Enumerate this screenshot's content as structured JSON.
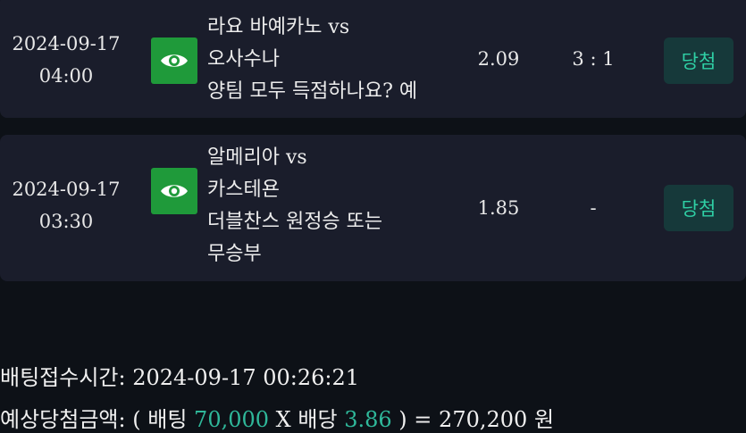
{
  "bets": [
    {
      "date": "2024-09-17",
      "time": "04:00",
      "match_lines": [
        "라요 바예카노 vs",
        "오사수나",
        "양팀 모두 득점하나요? 예"
      ],
      "odds": "2.09",
      "score": "3 : 1",
      "result": "당첨"
    },
    {
      "date": "2024-09-17",
      "time": "03:30",
      "match_lines": [
        "알메리아 vs",
        "카스테욘",
        "더블찬스 원정승 또는",
        "무승부"
      ],
      "odds": "1.85",
      "score": "-",
      "result": "당첨"
    }
  ],
  "summary": {
    "bet_time_label": "배팅접수시간:",
    "bet_time_value": "2024-09-17 00:26:21",
    "expected_label": "예상당첨금액:",
    "open_paren": "(",
    "stake_label": "배팅",
    "stake_value": "70,000",
    "times": "X",
    "odds_label": "배당",
    "odds_value": "3.86",
    "close_eq": ") =",
    "payout_value": "270,200",
    "currency": "원"
  },
  "colors": {
    "background": "#0d1117",
    "card": "#1a1d2b",
    "eye_button": "#1f9a3a",
    "badge_bg": "#16393a",
    "badge_text": "#2fd0a5",
    "highlight": "#2fb89a"
  },
  "icons": {
    "view": "eye-icon"
  }
}
